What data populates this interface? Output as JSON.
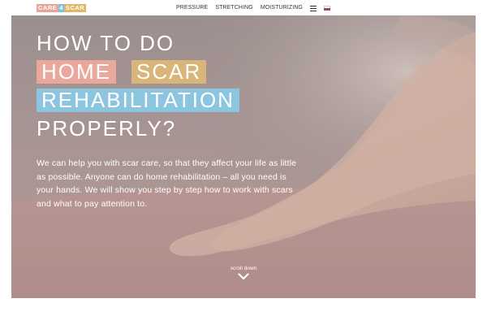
{
  "header": {
    "logo": {
      "part1": "CARE",
      "part2": "4",
      "part3": "SCAR"
    },
    "nav": [
      {
        "label": "PRESSURE"
      },
      {
        "label": "STRETCHING"
      },
      {
        "label": "MOISTURIZING"
      }
    ],
    "menu_icon": "hamburger-menu-icon",
    "language_icon": "language-flag-icon"
  },
  "hero": {
    "line1": "HOW TO DO",
    "tag_home": "HOME",
    "tag_scar": "SCAR",
    "tag_rehab": "REHABILITATION",
    "line4": "PROPERLY?",
    "body": "We can help you with scar care, so that they affect your life as little as possible. Anyone can do home rehabilitation – all you need is your hands. We will show you step by step how to work with scars and what to pay attention to.",
    "scroll_label": "scroll down",
    "scroll_icon": "chevron-down-icon"
  },
  "colors": {
    "pink": "#e9a89b",
    "gold": "#d9b57a",
    "blue": "#8cc5e0"
  }
}
